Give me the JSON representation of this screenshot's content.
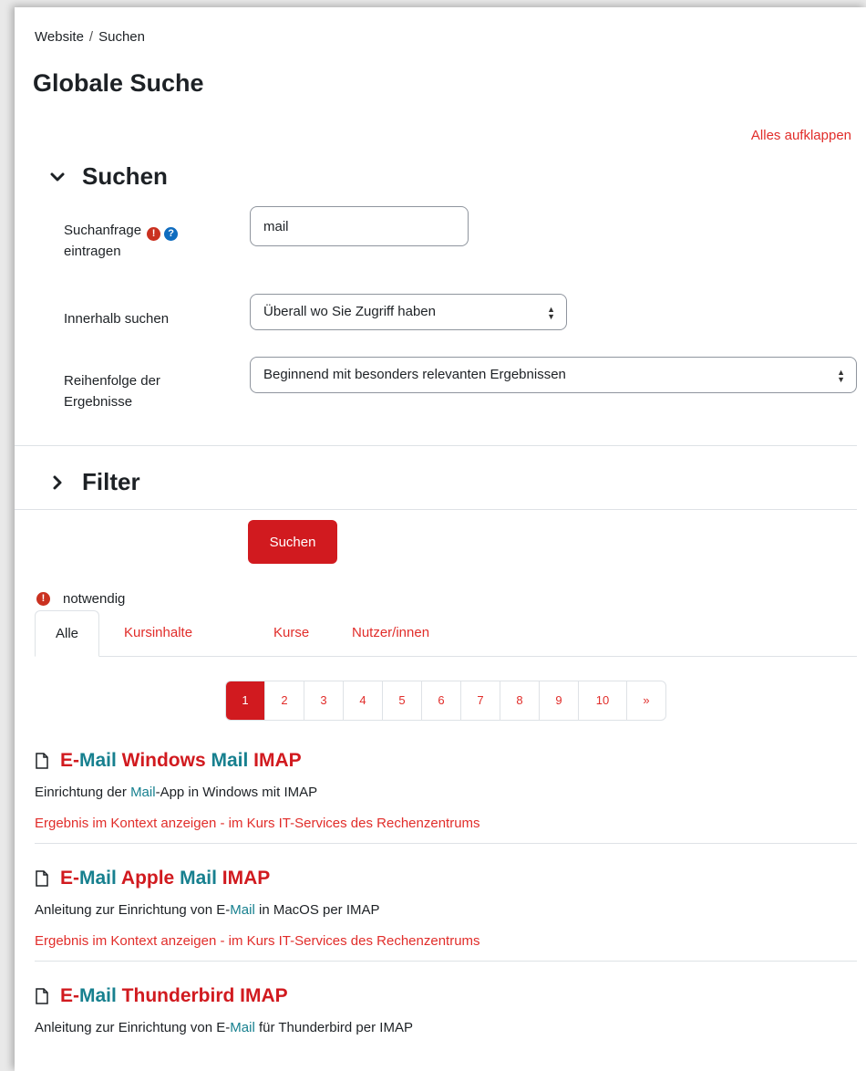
{
  "breadcrumb": {
    "item1": "Website",
    "separator": "/",
    "item2": "Suchen"
  },
  "page_title": "Globale Suche",
  "expand_all": "Alles aufklappen",
  "section_search": {
    "title": "Suchen"
  },
  "fields": {
    "query_label_1": "Suchanfrage",
    "query_label_2": "eintragen",
    "query_value": "mail",
    "within_label": "Innerhalb suchen",
    "within_value": "Überall wo Sie Zugriff haben",
    "order_label_1": "Reihenfolge der",
    "order_label_2": "Ergebnisse",
    "order_value": "Beginnend mit besonders relevanten Ergebnissen"
  },
  "section_filter": {
    "title": "Filter"
  },
  "search_button": "Suchen",
  "required_note": "notwendig",
  "tabs": [
    {
      "label": "Alle"
    },
    {
      "label": "Kursinhalte"
    },
    {
      "label": "Kurse"
    },
    {
      "label": "Nutzer/innen"
    }
  ],
  "pagination": [
    "1",
    "2",
    "3",
    "4",
    "5",
    "6",
    "7",
    "8",
    "9",
    "10",
    "»"
  ],
  "results": [
    {
      "t1": "E-",
      "t2": "Mail",
      "t3": " Windows ",
      "t4": "Mail",
      "t5": " IMAP",
      "d1": "Einrichtung der ",
      "d2": "Mail",
      "d3": "-App in Windows mit IMAP",
      "context": "Ergebnis im Kontext anzeigen - im Kurs IT-Services des Rechenzentrums"
    },
    {
      "t1": "E-",
      "t2": "Mail",
      "t3": " Apple ",
      "t4": "Mail",
      "t5": " IMAP",
      "d1": "Anleitung zur Einrichtung von E-",
      "d2": "Mail",
      "d3": " in MacOS per IMAP",
      "context": "Ergebnis im Kontext anzeigen - im Kurs IT-Services des Rechenzentrums"
    },
    {
      "t1": "E-",
      "t2": "Mail",
      "t3": " Thunderbird IMAP",
      "t4": "",
      "t5": "",
      "d1": "Anleitung zur Einrichtung von E-",
      "d2": "Mail",
      "d3": " für Thunderbird per IMAP",
      "context": ""
    }
  ],
  "colors": {
    "accent": "#d11a1f",
    "highlight": "#17808f",
    "link": "#e12d2a"
  }
}
